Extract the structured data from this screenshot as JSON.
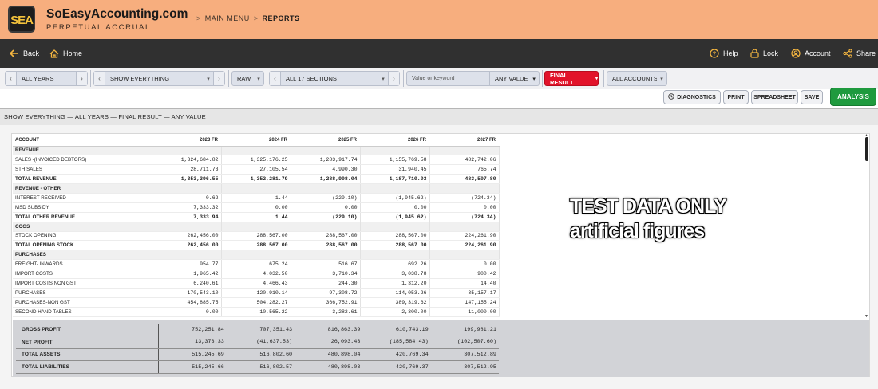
{
  "header": {
    "logo_text": "SEA",
    "brand": "SoEasyAccounting.com",
    "tagline": "PERPETUAL ACCRUAL",
    "breadcrumb": {
      "sep": ">",
      "main": "MAIN MENU",
      "current": "REPORTS"
    }
  },
  "nav": {
    "back": "Back",
    "home": "Home",
    "help": "Help",
    "lock": "Lock",
    "account": "Account",
    "share": "Share"
  },
  "filters": {
    "years": "ALL YEARS",
    "show": "SHOW EVERYTHING",
    "mode": "RAW",
    "sections": "ALL 17 SECTIONS",
    "keyword_placeholder": "Value or keyword",
    "value_filter": "ANY VALUE",
    "result": "FINAL RESULT",
    "accounts": "ALL ACCOUNTS"
  },
  "actions": {
    "diagnostics": "DIAGNOSTICS",
    "print": "PRINT",
    "spreadsheet": "SPREADSHEET",
    "save": "SAVE",
    "analysis": "ANALYSIS"
  },
  "summary": "SHOW EVERYTHING — ALL YEARS — FINAL RESULT — ANY VALUE",
  "report": {
    "columns": [
      "ACCOUNT",
      "2023 FR",
      "2024 FR",
      "2025 FR",
      "2026 FR",
      "2027 FR"
    ],
    "rows": [
      {
        "type": "section",
        "cells": [
          "REVENUE",
          "",
          "",
          "",
          "",
          ""
        ]
      },
      {
        "type": "item",
        "cells": [
          "SALES -(INVOICED DEBTORS)",
          "1,324,684.82",
          "1,325,176.25",
          "1,283,917.74",
          "1,155,769.58",
          "482,742.06"
        ]
      },
      {
        "type": "item",
        "cells": [
          "STH SALES",
          "28,711.73",
          "27,105.54",
          "4,990.30",
          "31,940.45",
          "765.74"
        ]
      },
      {
        "type": "total",
        "cells": [
          "TOTAL REVENUE",
          "1,353,396.55",
          "1,352,281.79",
          "1,288,908.04",
          "1,187,710.03",
          "483,507.80"
        ]
      },
      {
        "type": "section",
        "cells": [
          "REVENUE - OTHER",
          "",
          "",
          "",
          "",
          ""
        ]
      },
      {
        "type": "item",
        "cells": [
          "INTEREST RECEIVED",
          "0.62",
          "1.44",
          "(229.10)",
          "(1,945.62)",
          "(724.34)"
        ]
      },
      {
        "type": "item",
        "cells": [
          "MSD SUBSIDY",
          "7,333.32",
          "0.00",
          "0.00",
          "0.00",
          "0.00"
        ]
      },
      {
        "type": "total",
        "cells": [
          "TOTAL OTHER REVENUE",
          "7,333.94",
          "1.44",
          "(229.10)",
          "(1,945.62)",
          "(724.34)"
        ]
      },
      {
        "type": "section",
        "cells": [
          "COGS",
          "",
          "",
          "",
          "",
          ""
        ]
      },
      {
        "type": "item",
        "cells": [
          "STOCK OPENING",
          "262,456.00",
          "288,567.00",
          "288,567.00",
          "288,567.00",
          "224,261.90"
        ]
      },
      {
        "type": "total",
        "cells": [
          "TOTAL OPENING STOCK",
          "262,456.00",
          "288,567.00",
          "288,567.00",
          "288,567.00",
          "224,261.90"
        ]
      },
      {
        "type": "section",
        "cells": [
          "PURCHASES",
          "",
          "",
          "",
          "",
          ""
        ]
      },
      {
        "type": "item",
        "cells": [
          "FREIGHT- INWARDS",
          "954.77",
          "675.24",
          "516.67",
          "692.26",
          "0.00"
        ]
      },
      {
        "type": "item",
        "cells": [
          "IMPORT COSTS",
          "1,965.42",
          "4,032.50",
          "3,710.34",
          "3,038.78",
          "900.42"
        ]
      },
      {
        "type": "item",
        "cells": [
          "IMPORT COSTS NON GST",
          "6,240.61",
          "4,466.43",
          "244.30",
          "1,312.20",
          "14.40"
        ]
      },
      {
        "type": "item",
        "cells": [
          "PURCHASES",
          "170,543.10",
          "120,910.14",
          "97,308.72",
          "114,053.26",
          "35,157.17"
        ]
      },
      {
        "type": "item",
        "cells": [
          "PURCHASES-NON GST",
          "454,885.75",
          "504,282.27",
          "366,752.91",
          "389,319.62",
          "147,155.24"
        ]
      },
      {
        "type": "item",
        "cells": [
          "SECOND HAND TABLES",
          "0.00",
          "10,565.22",
          "3,282.61",
          "2,300.00",
          "11,000.00"
        ]
      }
    ],
    "footer": [
      [
        "GROSS PROFIT",
        "752,251.84",
        "707,351.43",
        "816,863.39",
        "610,743.19",
        "199,981.21"
      ],
      [
        "NET PROFIT",
        "13,373.33",
        "(41,637.53)",
        "26,093.43",
        "(185,584.43)",
        "(102,507.60)"
      ],
      [
        "TOTAL ASSETS",
        "515,245.69",
        "516,802.60",
        "480,898.04",
        "420,769.34",
        "307,512.89"
      ],
      [
        "TOTAL LIABILITIES",
        "515,245.66",
        "516,802.57",
        "480,898.03",
        "420,769.37",
        "307,512.95"
      ]
    ]
  },
  "watermark": {
    "line1": "TEST DATA ONLY",
    "line2": "artificial figures"
  },
  "colors": {
    "header_bg": "#f7ae7e",
    "nav_bg": "#303030",
    "nav_icon": "#f6b740",
    "final_result": "#e2132a",
    "analysis": "#1f9a3e"
  }
}
